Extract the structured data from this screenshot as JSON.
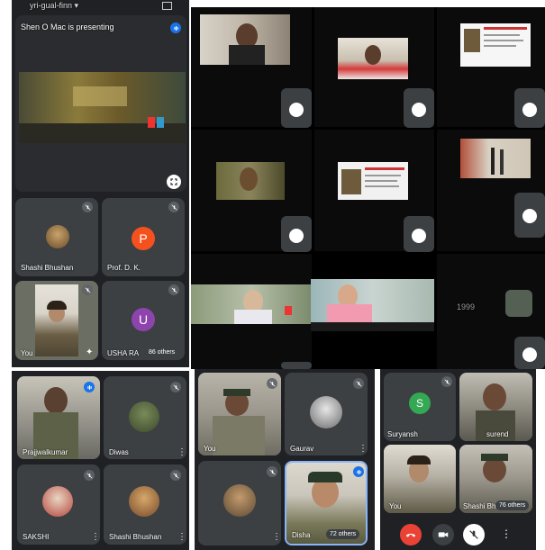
{
  "left_top": {
    "meeting_code": "yri-gual-finn ▾",
    "presenting_text": "Shen O Mac is presenting",
    "participants": [
      {
        "name": "Shashi Bhushan"
      },
      {
        "name": "Prof. D. K."
      },
      {
        "name": "You"
      },
      {
        "name": "USHA RA"
      }
    ],
    "avatar_letters": {
      "prof": "P",
      "usha": "U"
    },
    "others_badge": "86 others"
  },
  "right_top": {
    "video_captions": [
      "1999"
    ]
  },
  "bottom_left": {
    "participants": [
      {
        "name": "Prajjwalkumar"
      },
      {
        "name": "Diwas"
      },
      {
        "name": "SAKSHI"
      },
      {
        "name": "Shashi Bhushan"
      }
    ]
  },
  "bottom_mid": {
    "participants": [
      {
        "name": "You"
      },
      {
        "name": "Gaurav"
      },
      {
        "name": ""
      },
      {
        "name": "Disha"
      }
    ],
    "others_badge": "72 others"
  },
  "bottom_right": {
    "participants": [
      {
        "name": "Suryansh"
      },
      {
        "name": "surend"
      },
      {
        "name": "You"
      },
      {
        "name": "Shashi Bh"
      }
    ],
    "avatar_letter": "S",
    "others_badge": "76 others"
  },
  "colors": {
    "meet_dark": "#202124",
    "tile": "#3c4043",
    "mic_blue": "#1a73e8",
    "end_call_red": "#ea4335",
    "avatar_orange": "#f4511e",
    "avatar_purple": "#8e44ad",
    "avatar_green": "#34a853"
  },
  "icons": [
    "mic-off-icon",
    "mic-on-icon",
    "fullscreen-icon",
    "more-vert-icon",
    "end-call-icon",
    "camera-icon",
    "sparkle-icon"
  ]
}
